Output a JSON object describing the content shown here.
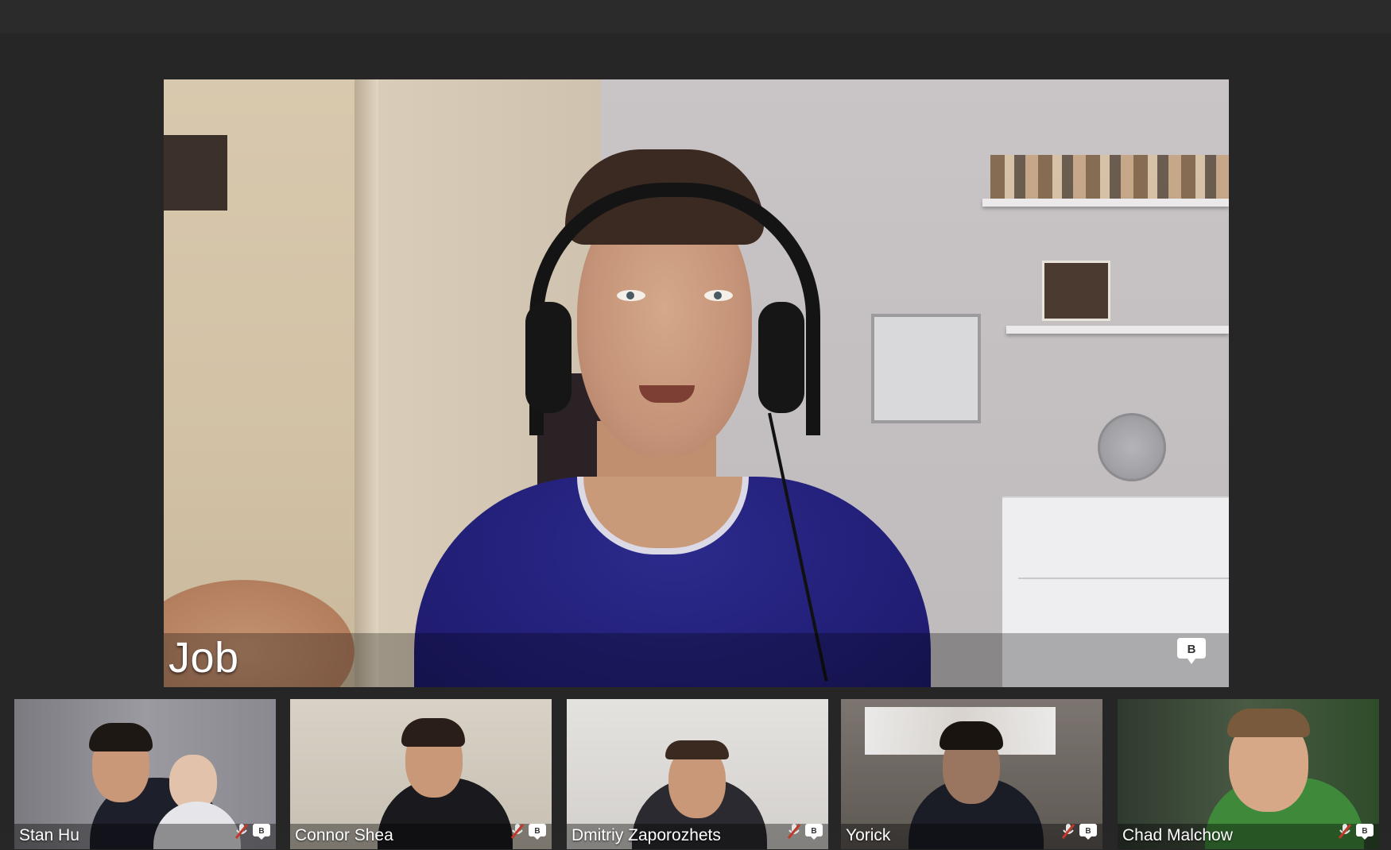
{
  "main_speaker": {
    "name": "Job",
    "chat_icon": "chat-bubble-icon"
  },
  "participants": [
    {
      "name": "Stan Hu",
      "mic_icon": "mic-muted-icon",
      "chat_icon": "chat-bubble-icon"
    },
    {
      "name": "Connor Shea",
      "mic_icon": "mic-muted-icon",
      "chat_icon": "chat-bubble-icon"
    },
    {
      "name": "Dmitriy Zaporozhets",
      "mic_icon": "mic-muted-icon",
      "chat_icon": "chat-bubble-icon"
    },
    {
      "name": "Yorick",
      "mic_icon": "mic-muted-icon",
      "chat_icon": "chat-bubble-icon"
    },
    {
      "name": "Chad Malchow",
      "mic_icon": "mic-muted-icon",
      "chat_icon": "chat-bubble-icon"
    }
  ],
  "colors": {
    "background": "#262626",
    "top_bar": "#2b2b2b",
    "label_text": "#ffffff",
    "mic_muted_red": "#c0392b"
  }
}
